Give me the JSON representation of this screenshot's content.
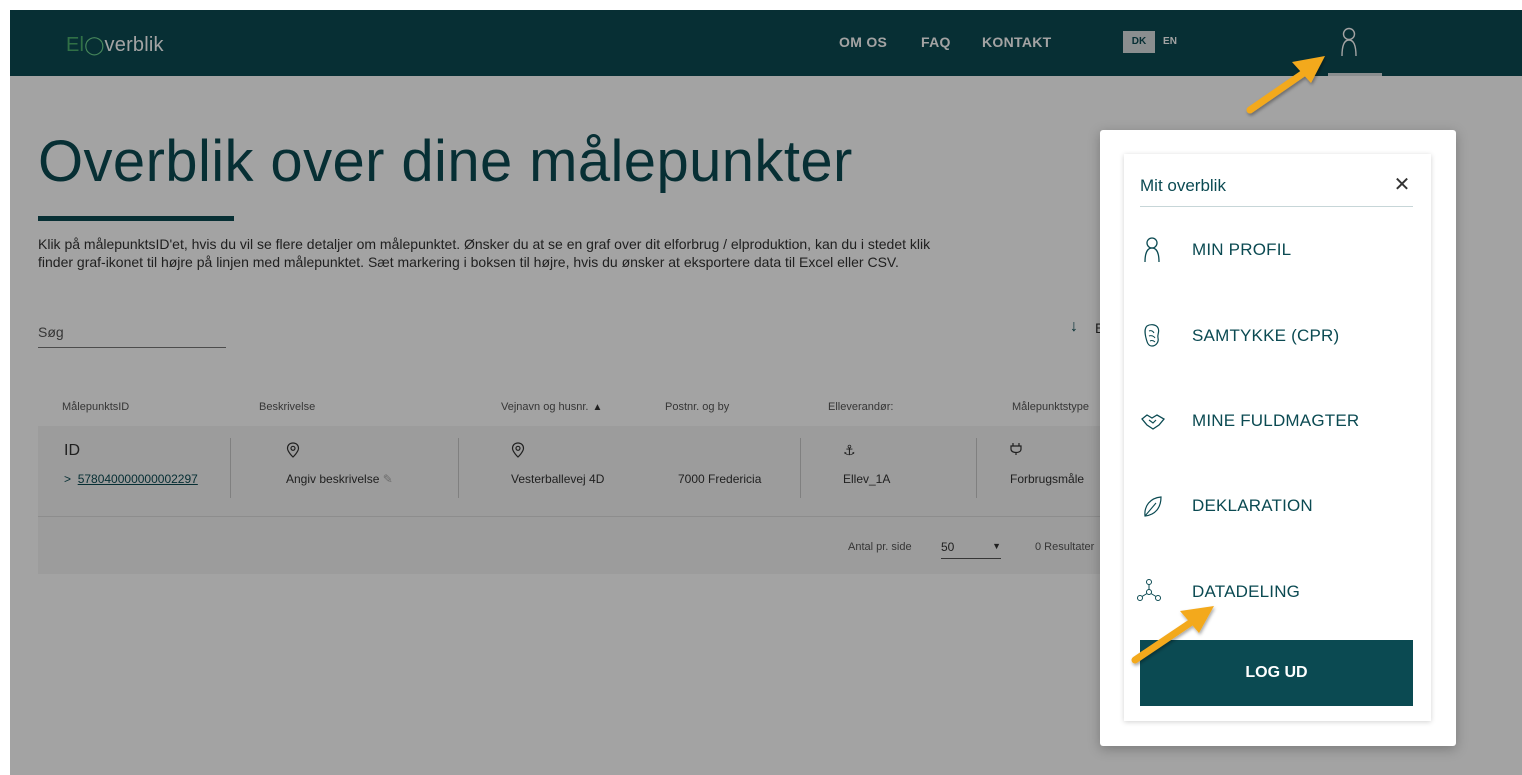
{
  "header": {
    "logo_el": "El",
    "logo_rest": "verblik",
    "nav": [
      "OM OS",
      "FAQ",
      "KONTAKT"
    ],
    "lang_dk": "DK",
    "lang_en": "EN"
  },
  "main": {
    "title": "Overblik over dine målepunkter",
    "intro_line1": "Klik på målepunktsID'et, hvis du vil se flere detaljer om målepunktet. Ønsker du at se en graf over dit elforbrug / elproduktion, kan du i stedet klik",
    "intro_line2": "finder graf-ikonet til højre på linjen med målepunktet. Sæt markering i boksen til højre, hvis du ønsker at eksportere data til Excel eller CSV.",
    "search_label": "Søg",
    "export_label": "E",
    "columns": [
      "MålepunktsID",
      "Beskrivelse",
      "Vejnavn og husnr.",
      "Postnr. og by",
      "Elleverandør:",
      "Målepunktstype"
    ],
    "row": {
      "id_label": "ID",
      "id_value": "578040000000002297",
      "description": "Angiv beskrivelse",
      "street": "Vesterballevej 4D",
      "postal": "7000 Fredericia",
      "supplier": "Ellev_1A",
      "type": "Forbrugsmåle"
    },
    "pager": {
      "per_page_label": "Antal pr. side",
      "per_page_value": "50",
      "results": "0 Resultater"
    }
  },
  "panel": {
    "title": "Mit overblik",
    "items": [
      {
        "label": "MIN PROFIL",
        "icon": "person-icon"
      },
      {
        "label": "SAMTYKKE (CPR)",
        "icon": "consent-icon"
      },
      {
        "label": "MINE FULDMAGTER",
        "icon": "handshake-icon"
      },
      {
        "label": "DEKLARATION",
        "icon": "leaf-icon"
      },
      {
        "label": "DATADELING",
        "icon": "network-icon"
      }
    ],
    "logout_label": "LOG UD"
  },
  "colors": {
    "brand": "#0b4a52",
    "annotation_arrow": "#f3a91f"
  }
}
